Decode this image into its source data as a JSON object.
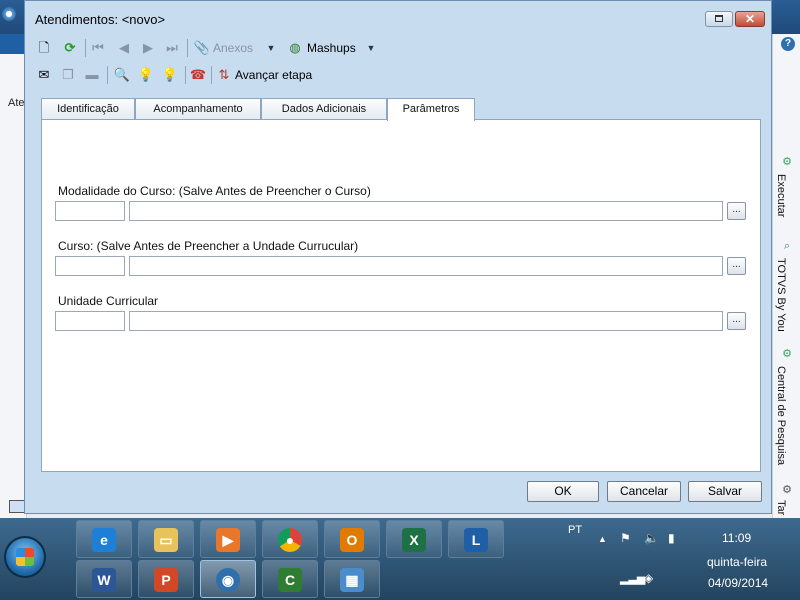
{
  "background": {
    "left_label": "Ate",
    "right_panel": [
      {
        "label": "Executar",
        "icon": "gear-icon"
      },
      {
        "label": "TOTVS By You",
        "icon": "search-icon"
      },
      {
        "label": "Central de Pesquisa",
        "icon": "gear-icon"
      },
      {
        "label": "Tar",
        "icon": "gear-icon"
      }
    ],
    "help_label": "?"
  },
  "dialog": {
    "title": "Atendimentos: <novo>",
    "close_label": "✕"
  },
  "toolbar1": {
    "attachments_label": "Anexos",
    "mashups_label": "Mashups"
  },
  "toolbar2": {
    "advance_label": "Avançar etapa"
  },
  "tabs": [
    {
      "label": "Identificação",
      "active": false
    },
    {
      "label": "Acompanhamento",
      "active": false
    },
    {
      "label": "Dados Adicionais",
      "active": false
    },
    {
      "label": "Parâmetros",
      "active": true
    }
  ],
  "fields": [
    {
      "label": "Modalidade do Curso: (Salve Antes de Preencher o Curso)",
      "code": "",
      "description": ""
    },
    {
      "label": "Curso: (Salve Antes de Preencher a Undade Currucular)",
      "code": "",
      "description": ""
    },
    {
      "label": "Unidade Curricular",
      "code": "",
      "description": ""
    }
  ],
  "lookup_label": "...",
  "buttons": {
    "ok": "OK",
    "cancel": "Cancelar",
    "save": "Salvar"
  },
  "taskbar": {
    "language": "PT",
    "time": "11:09",
    "weekday": "quinta-feira",
    "date": "04/09/2014"
  },
  "colors": {
    "dialog_bg": "#c8dcf0",
    "taskbar": "#2f5676"
  }
}
